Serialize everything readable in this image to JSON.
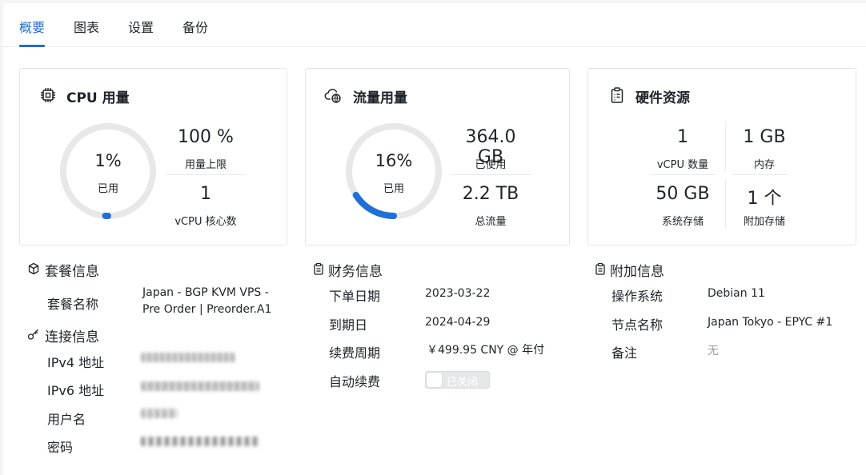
{
  "tabs": [
    {
      "label": "概要",
      "active": true
    },
    {
      "label": "图表",
      "active": false
    },
    {
      "label": "设置",
      "active": false
    },
    {
      "label": "备份",
      "active": false
    }
  ],
  "cpu_card": {
    "title": "CPU 用量",
    "icon": "cpu-chip-icon",
    "usage_value": "1%",
    "usage_fraction": 0.01,
    "usage_label": "已用",
    "limit_value": "100 %",
    "limit_label": "用量上限",
    "cores_value": "1",
    "cores_label": "vCPU 核心数"
  },
  "traffic_card": {
    "title": "流量用量",
    "icon": "cloud-network-icon",
    "usage_value": "16%",
    "usage_fraction": 0.16,
    "usage_label": "已用",
    "used_value": "364.0 GB",
    "used_label": "已使用",
    "total_value": "2.2 TB",
    "total_label": "总流量"
  },
  "hardware_card": {
    "title": "硬件资源",
    "icon": "clipboard-icon",
    "vcpu_value": "1",
    "vcpu_label": "vCPU 数量",
    "memory_value": "1 GB",
    "memory_label": "内存",
    "storage_value": "50 GB",
    "storage_label": "系统存储",
    "extra_storage_value": "1 个",
    "extra_storage_label": "附加存储"
  },
  "plan_section": {
    "title": "套餐信息",
    "icon": "package-icon",
    "name_label": "套餐名称",
    "name_value_line1": "Japan - BGP KVM VPS -",
    "name_value_line2": "Pre Order | Preorder.A1"
  },
  "connection_section": {
    "title": "连接信息",
    "icon": "key-icon",
    "ipv4_label": "IPv4 地址",
    "ipv6_label": "IPv6 地址",
    "username_label": "用户名",
    "password_label": "密码"
  },
  "finance_section": {
    "title": "财务信息",
    "icon": "clipboard-icon",
    "order_date_label": "下单日期",
    "order_date_value": "2023-03-22",
    "expiry_label": "到期日",
    "expiry_value": "2024-04-29",
    "renewal_label": "续费周期",
    "renewal_value": "￥499.95 CNY @ 年付",
    "auto_renew_label": "自动续费",
    "auto_renew_state": "已关闭",
    "auto_renew_on": false
  },
  "extra_section": {
    "title": "附加信息",
    "icon": "clipboard-icon",
    "os_label": "操作系统",
    "os_value": "Debian 11",
    "node_label": "节点名称",
    "node_value": "Japan Tokyo - EPYC #1",
    "note_label": "备注",
    "note_value": "无"
  },
  "colors": {
    "accent": "#1f6fd8",
    "ring_track": "#e8e8e8",
    "border": "#e3e5e8"
  }
}
